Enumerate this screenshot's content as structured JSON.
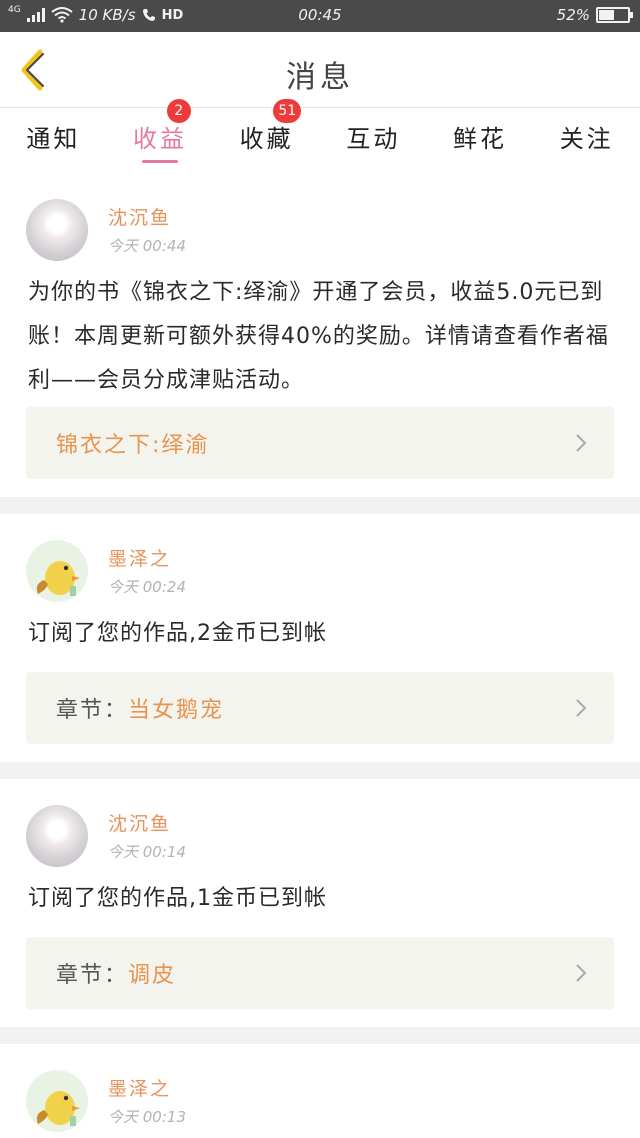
{
  "status_bar": {
    "network": "4G",
    "speed": "10 KB/s",
    "hd": "HD",
    "time": "00:45",
    "battery_percent": 52
  },
  "header": {
    "title": "消息"
  },
  "tabs": [
    {
      "label": "通知",
      "badge": "",
      "active": false
    },
    {
      "label": "收益",
      "badge": "2",
      "active": true
    },
    {
      "label": "收藏",
      "badge": "51",
      "active": false
    },
    {
      "label": "互动",
      "badge": "",
      "active": false
    },
    {
      "label": "鲜花",
      "badge": "",
      "active": false
    },
    {
      "label": "关注",
      "badge": "",
      "active": false
    }
  ],
  "messages": [
    {
      "user": "沈沉鱼",
      "time": "今天 00:44",
      "text": "为你的书《锦衣之下:绎渝》开通了会员，收益5.0元已到账！本周更新可额外获得40%的奖励。详情请查看作者福利——会员分成津贴活动。",
      "link_prefix": "",
      "link_value": "锦衣之下:绎渝",
      "avatar": "cloud"
    },
    {
      "user": "墨泽之",
      "time": "今天 00:24",
      "text": "订阅了您的作品,2金币已到帐",
      "link_prefix": "章节：",
      "link_value": "当女鹅宠",
      "avatar": "bird"
    },
    {
      "user": "沈沉鱼",
      "time": "今天 00:14",
      "text": "订阅了您的作品,1金币已到帐",
      "link_prefix": "章节：",
      "link_value": "调皮",
      "avatar": "cloud"
    },
    {
      "user": "墨泽之",
      "time": "今天 00:13",
      "avatar": "bird"
    }
  ]
}
